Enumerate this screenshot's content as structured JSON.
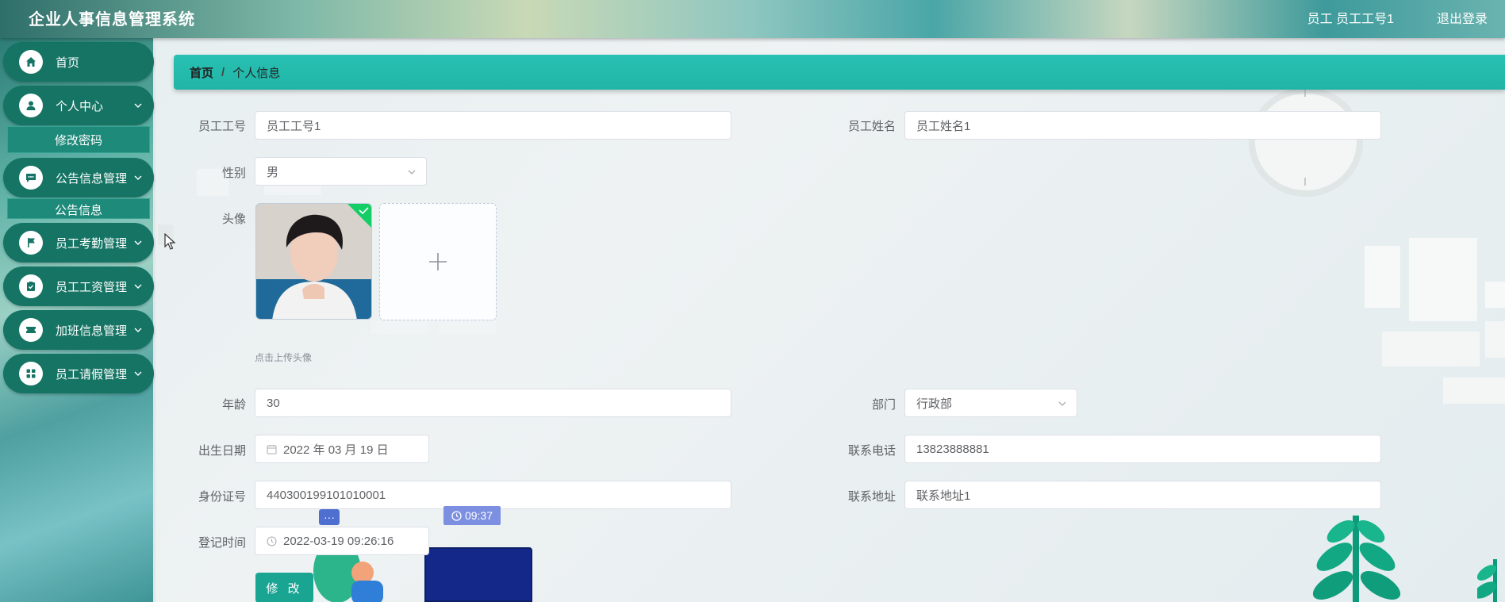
{
  "app": {
    "title": "企业人事信息管理系统"
  },
  "header": {
    "user_text": "员工  员工工号1",
    "logout_label": "退出登录"
  },
  "sidebar": {
    "items": [
      {
        "label": "首页",
        "icon": "home-icon"
      },
      {
        "label": "个人中心",
        "icon": "user-icon"
      },
      {
        "label": "公告信息管理",
        "icon": "message-icon"
      },
      {
        "label": "员工考勤管理",
        "icon": "flag-icon"
      },
      {
        "label": "员工工资管理",
        "icon": "clipboard-check-icon"
      },
      {
        "label": "加班信息管理",
        "icon": "ticket-icon"
      },
      {
        "label": "员工请假管理",
        "icon": "grid-icon"
      }
    ],
    "sub_items": [
      {
        "label": "修改密码"
      },
      {
        "label": "公告信息"
      }
    ]
  },
  "breadcrumb": {
    "home": "首页",
    "separator": "/",
    "current": "个人信息"
  },
  "form": {
    "employee_no": {
      "label": "员工工号",
      "value": "员工工号1"
    },
    "employee_name": {
      "label": "员工姓名",
      "value": "员工姓名1"
    },
    "gender": {
      "label": "性别",
      "value": "男"
    },
    "avatar": {
      "label": "头像",
      "hint": "点击上传头像"
    },
    "age": {
      "label": "年龄",
      "value": "30"
    },
    "department": {
      "label": "部门",
      "value": "行政部"
    },
    "birth_date": {
      "label": "出生日期",
      "value": "2022 年 03 月 19 日"
    },
    "phone": {
      "label": "联系电话",
      "value": "13823888881"
    },
    "id_card": {
      "label": "身份证号",
      "value": "440300199101010001"
    },
    "address": {
      "label": "联系地址",
      "value": "联系地址1"
    },
    "register_time": {
      "label": "登记时间",
      "value": "2022-03-19 09:26:16"
    },
    "submit_label": "修 改"
  },
  "overlay": {
    "time_badge": "09:37",
    "chat_badge": "···"
  },
  "colors": {
    "primary": "#157464",
    "accent": "#1fb4a6",
    "button": "#1aa592"
  }
}
